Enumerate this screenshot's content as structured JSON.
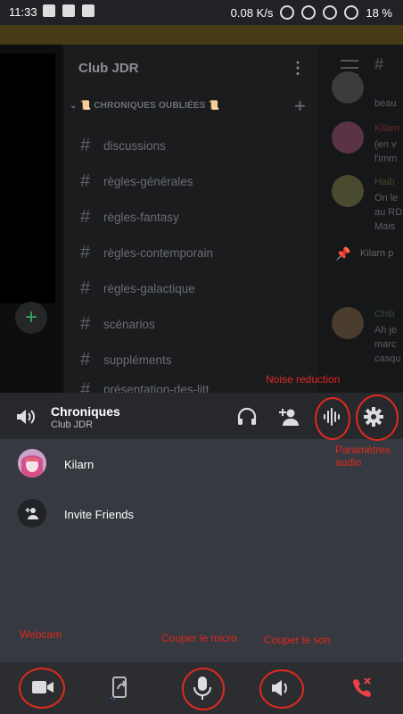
{
  "status_bar": {
    "time": "11:33",
    "net_speed": "0.08 K/s",
    "battery": "18 %"
  },
  "server": {
    "name": "Club JDR",
    "category": "📜 CHRONIQUES OUBLIÉES 📜",
    "channels": [
      "discussions",
      "règles-générales",
      "règles-fantasy",
      "règles-contemporain",
      "règles-galactique",
      "scénarios",
      "suppléments",
      "présentation-des-litt"
    ]
  },
  "background_chat": {
    "m1": {
      "text1": "beau"
    },
    "m2": {
      "name": "Kilarn",
      "text1": "(en v",
      "text2": "l'imm"
    },
    "m3": {
      "name": "Haib",
      "text1": "On le",
      "text2": "au RD",
      "text3": "Mais"
    },
    "pinned": {
      "name": "Kilarn p"
    },
    "m4": {
      "name": "Chib",
      "text1": "Ah je",
      "text2": "marc",
      "text3": "casqu"
    }
  },
  "voice_panel": {
    "channel_name": "Chroniques",
    "server_name": "Club JDR",
    "participants": [
      {
        "name": "Kilarn"
      }
    ],
    "invite_label": "Invite Friends"
  },
  "annotations": {
    "noise_reduction": "Noise reduction",
    "audio_settings_1": "Paramètres",
    "audio_settings_2": "audio",
    "webcam": "Webcam",
    "mute_mic": "Couper le micro",
    "deafen": "Couper le son"
  },
  "icons": [
    "speaker-icon",
    "headphones-icon",
    "add-user-icon",
    "noise-suppression-icon",
    "gear-icon",
    "camera-icon",
    "screen-share-icon",
    "microphone-icon",
    "volume-icon",
    "hang-up-icon"
  ],
  "colors": {
    "annotation_red": "#e0291f",
    "hangup_red": "#ed4245",
    "panel_bg": "#36393f",
    "header_bg": "#26282c"
  }
}
